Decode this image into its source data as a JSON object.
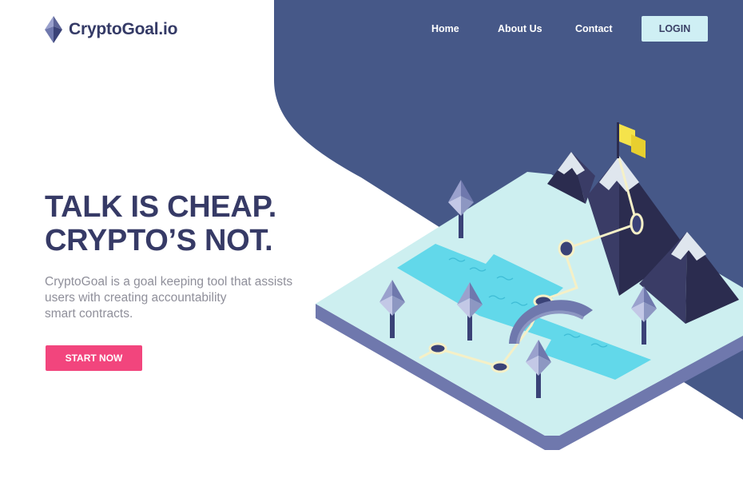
{
  "brand": {
    "name": "CryptoGoal.io",
    "logo_icon": "ethereum-diamond-icon"
  },
  "nav": {
    "items": [
      {
        "label": "Home"
      },
      {
        "label": "About Us"
      },
      {
        "label": "Contact"
      }
    ],
    "login_label": "LOGIN"
  },
  "hero": {
    "headline_lines": [
      "TALK IS CHEAP.",
      "CRYPTO’S NOT."
    ],
    "description_lines": [
      "CryptoGoal is a goal keeping tool that assists",
      "users with creating accountability",
      "smart contracts."
    ],
    "cta_label": "START NOW"
  },
  "colors": {
    "navy": "#465888",
    "heading": "#363a66",
    "cta": "#f2457d",
    "login_bg": "#cfeff4",
    "island": "#cdeff0",
    "water": "#62d8ea",
    "flag": "#f5e34b"
  }
}
